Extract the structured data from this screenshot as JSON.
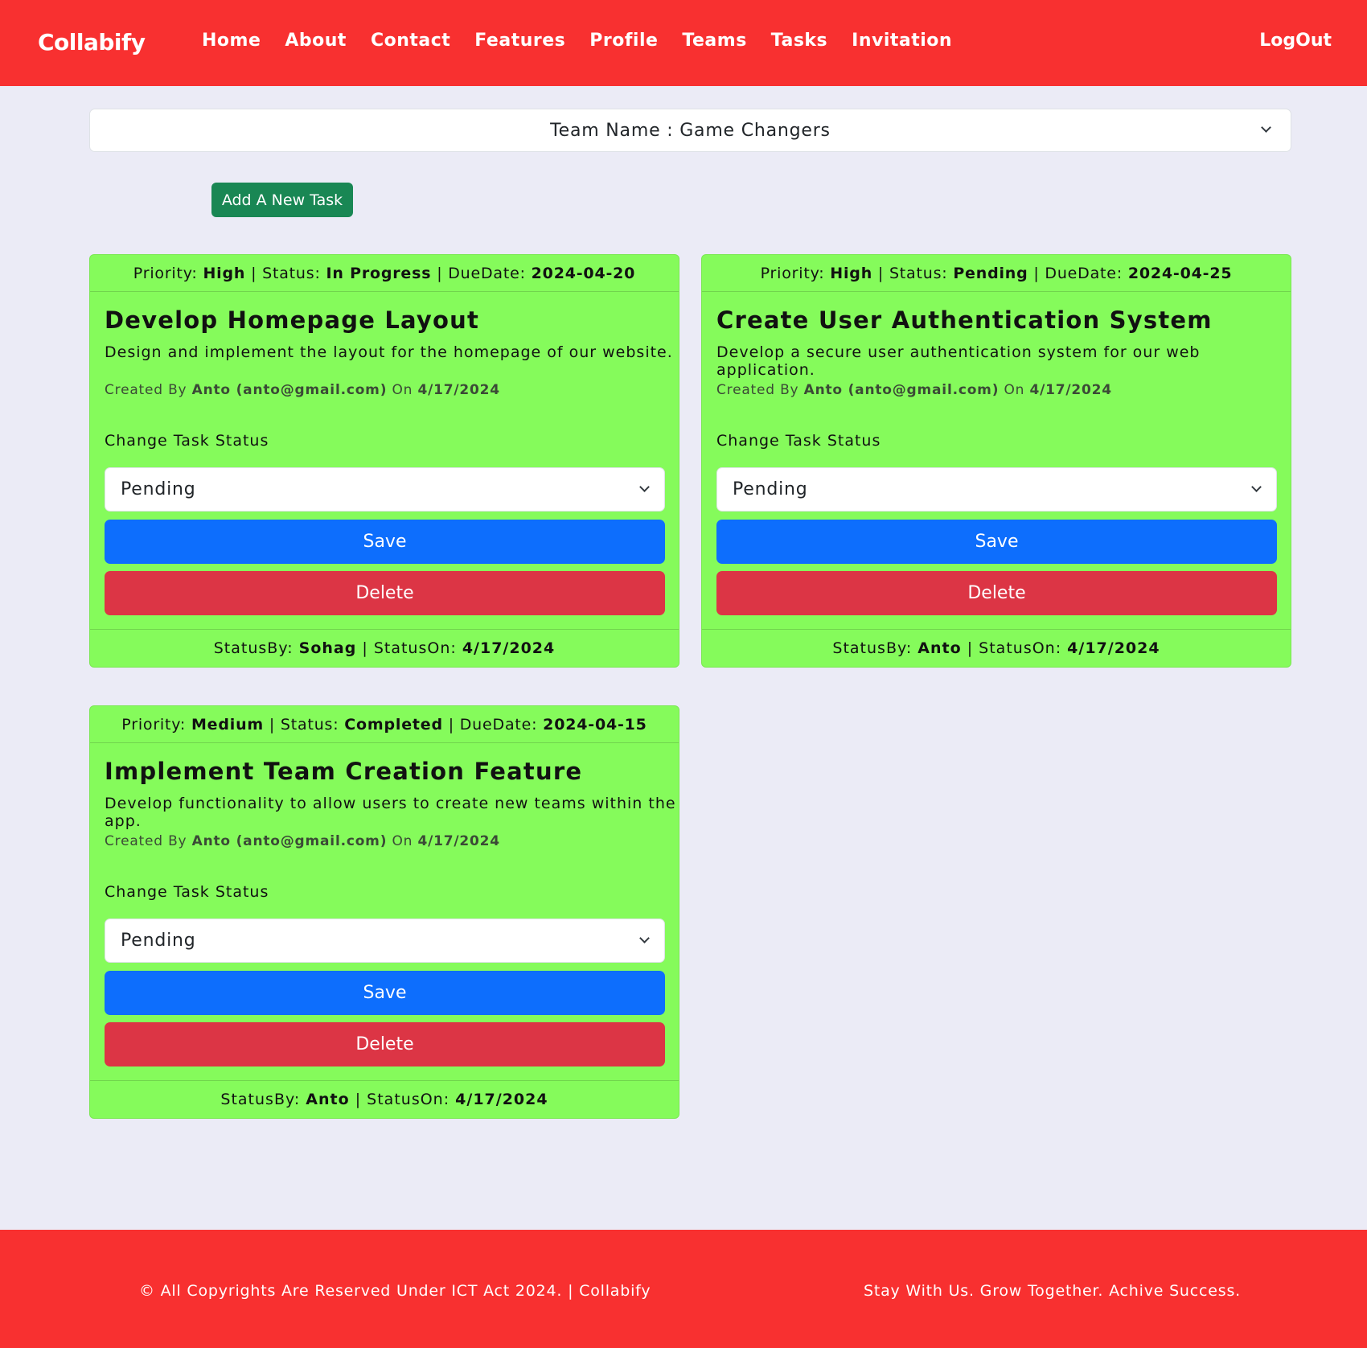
{
  "navbar": {
    "brand": "Collabify",
    "links": [
      "Home",
      "About",
      "Contact",
      "Features",
      "Profile",
      "Teams",
      "Tasks",
      "Invitation"
    ],
    "logout": "LogOut"
  },
  "team_select": {
    "value": "Team Name : Game Changers"
  },
  "add_task_label": "Add A New Task",
  "labels": {
    "priority": "Priority:",
    "status": "Status:",
    "due": "DueDate:",
    "created_by": "Created By",
    "on": "On",
    "change_status": "Change Task Status",
    "save": "Save",
    "delete": "Delete",
    "status_by": "StatusBy:",
    "status_on": "StatusOn:",
    "sep": "|"
  },
  "tasks": [
    {
      "priority": "High",
      "status": "In Progress",
      "due_date": "2024-04-20",
      "title": "Develop Homepage Layout",
      "description": "Design and implement the layout for the homepage of our website.",
      "creator": "Anto (anto@gmail.com)",
      "created_on": "4/17/2024",
      "selected_status": "Pending",
      "status_by": "Sohag",
      "status_on": "4/17/2024"
    },
    {
      "priority": "High",
      "status": "Pending",
      "due_date": "2024-04-25",
      "title": "Create User Authentication System",
      "description": "Develop a secure user authentication system for our web application.",
      "creator": "Anto (anto@gmail.com)",
      "created_on": "4/17/2024",
      "selected_status": "Pending",
      "status_by": "Anto",
      "status_on": "4/17/2024"
    },
    {
      "priority": "Medium",
      "status": "Completed",
      "due_date": "2024-04-15",
      "title": "Implement Team Creation Feature",
      "description": "Develop functionality to allow users to create new teams within the app.",
      "creator": "Anto (anto@gmail.com)",
      "created_on": "4/17/2024",
      "selected_status": "Pending",
      "status_by": "Anto",
      "status_on": "4/17/2024"
    }
  ],
  "footer": {
    "left": "© All Copyrights Are Reserved Under ICT Act 2024. | Collabify",
    "right": "Stay With Us. Grow Together. Achive Success."
  },
  "colors": {
    "navbar": "#f83030",
    "card": "#85fb5b",
    "save": "#0d6efd",
    "delete": "#dc3545",
    "add": "#198754",
    "background": "#ebebf6"
  }
}
